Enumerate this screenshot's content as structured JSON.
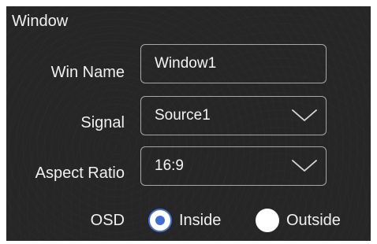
{
  "window_panel": {
    "title": "Window",
    "win_name": {
      "label": "Win Name",
      "value": "Window1"
    },
    "signal": {
      "label": "Signal",
      "selected": "Source1",
      "chevron_icon": "chevron-down-icon"
    },
    "aspect_ratio": {
      "label": "Aspect Ratio",
      "selected": "16:9",
      "chevron_icon": "chevron-down-icon"
    },
    "osd": {
      "label": "OSD",
      "options": [
        {
          "label": "Inside",
          "checked": true
        },
        {
          "label": "Outside",
          "checked": false
        }
      ]
    }
  },
  "colors": {
    "panel_background": "#262626",
    "text": "#f0f0f0",
    "field_border": "#a8a8a8",
    "radio_accent": "#3f6fd6"
  }
}
